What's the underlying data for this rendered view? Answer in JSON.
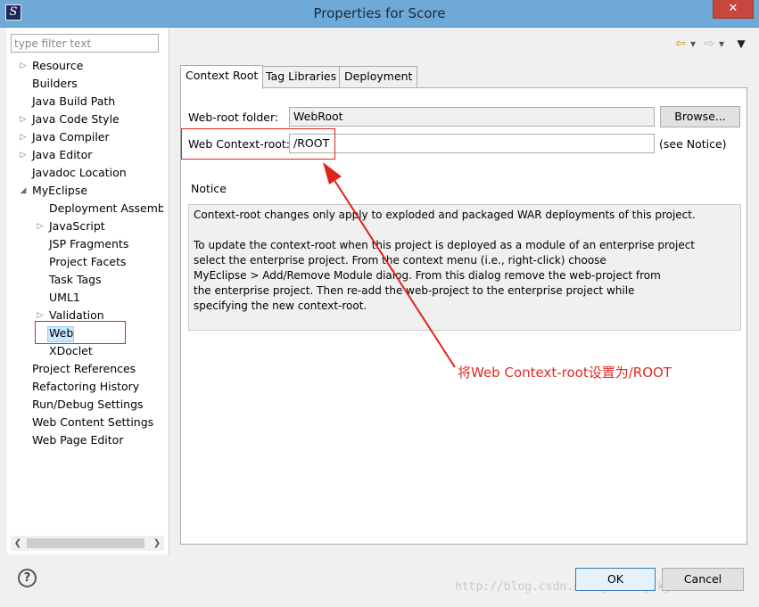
{
  "window": {
    "title": "Properties for Score",
    "app_icon": "S",
    "close": "✕"
  },
  "sidebar": {
    "filter_placeholder": "type filter text",
    "items": [
      {
        "label": "Resource",
        "expandable": true,
        "level": 0
      },
      {
        "label": "Builders",
        "expandable": false,
        "level": 0
      },
      {
        "label": "Java Build Path",
        "expandable": false,
        "level": 0
      },
      {
        "label": "Java Code Style",
        "expandable": true,
        "level": 0
      },
      {
        "label": "Java Compiler",
        "expandable": true,
        "level": 0
      },
      {
        "label": "Java Editor",
        "expandable": true,
        "level": 0
      },
      {
        "label": "Javadoc Location",
        "expandable": false,
        "level": 0
      },
      {
        "label": "MyEclipse",
        "expandable": true,
        "expanded": true,
        "level": 0
      },
      {
        "label": "Deployment Assembl",
        "expandable": false,
        "level": 1
      },
      {
        "label": "JavaScript",
        "expandable": true,
        "level": 1
      },
      {
        "label": "JSP Fragments",
        "expandable": false,
        "level": 1
      },
      {
        "label": "Project Facets",
        "expandable": false,
        "level": 1
      },
      {
        "label": "Task Tags",
        "expandable": false,
        "level": 1
      },
      {
        "label": "UML1",
        "expandable": false,
        "level": 1
      },
      {
        "label": "Validation",
        "expandable": true,
        "level": 1
      },
      {
        "label": "Web",
        "expandable": false,
        "level": 1,
        "selected": true
      },
      {
        "label": "XDoclet",
        "expandable": false,
        "level": 1
      },
      {
        "label": "Project References",
        "expandable": false,
        "level": 0
      },
      {
        "label": "Refactoring History",
        "expandable": false,
        "level": 0
      },
      {
        "label": "Run/Debug Settings",
        "expandable": false,
        "level": 0
      },
      {
        "label": "Web Content Settings",
        "expandable": false,
        "level": 0
      },
      {
        "label": "Web Page Editor",
        "expandable": false,
        "level": 0
      }
    ]
  },
  "nav": {
    "back_icon": "back-arrow-icon",
    "forward_icon": "forward-arrow-icon"
  },
  "tabs": [
    {
      "label": "Context Root",
      "active": true
    },
    {
      "label": "Tag Libraries",
      "active": false
    },
    {
      "label": "Deployment",
      "active": false
    }
  ],
  "form": {
    "web_root_label": "Web-root folder:",
    "web_root_value": "WebRoot",
    "browse_label": "Browse...",
    "context_root_label": "Web Context-root:",
    "context_root_value": "/ROOT",
    "see_notice": "(see Notice)"
  },
  "notice": {
    "heading": "Notice",
    "paragraph1": "Context-root changes only apply to exploded and packaged WAR deployments of this project.",
    "paragraph2_lines": [
      "To update the context-root when this project is deployed as a module of an enterprise project",
      "select the enterprise project. From the context menu (i.e., right-click) choose",
      "MyEclipse > Add/Remove Module dialog. From this dialog remove the web-project from",
      "the enterprise project. Then re-add the web-project to the enterprise project while",
      "specifying the new context-root."
    ]
  },
  "annotation": {
    "text": "将Web Context-root设置为/ROOT",
    "color": "#e0241c"
  },
  "footer": {
    "help": "?",
    "ok_label": "OK",
    "cancel_label": "Cancel",
    "watermark": "http://blog.csdn.net/jdrkldjfkjdl"
  },
  "colors": {
    "titlebar": "#6fa9d8",
    "close_button": "#c7463d",
    "selection": "#cce8ff"
  }
}
